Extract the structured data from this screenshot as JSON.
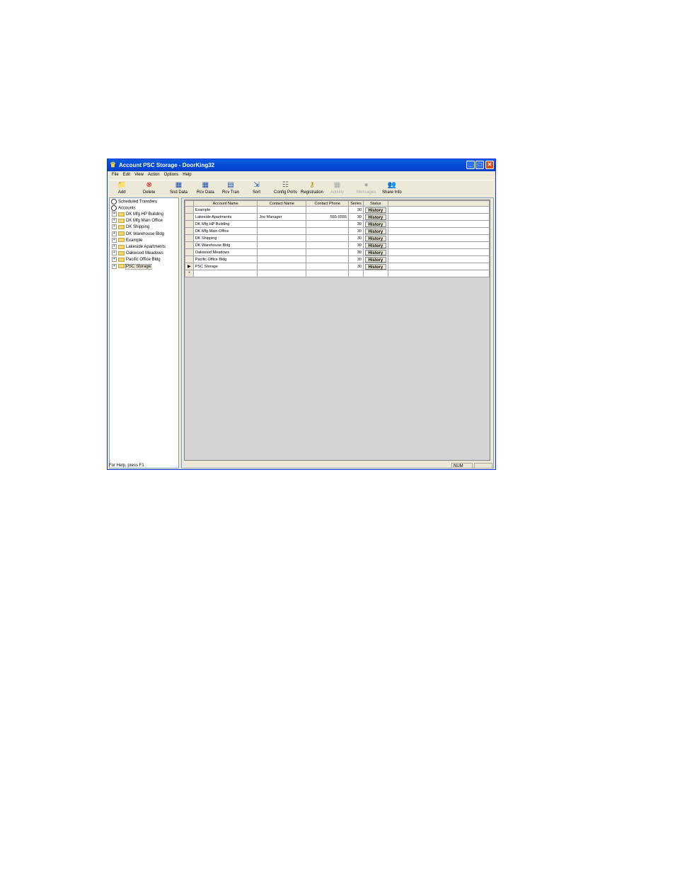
{
  "window": {
    "title": "Account PSC Storage - DoorKing32",
    "minimize_glyph": "_",
    "maximize_glyph": "□",
    "close_glyph": "✕"
  },
  "menu": [
    "File",
    "Edit",
    "View",
    "Action",
    "Options",
    "Help"
  ],
  "toolbar": [
    {
      "label": "Add",
      "icon": "add-folder-icon",
      "glyph": "📁",
      "color": "#c8a200",
      "enabled": true
    },
    {
      "label": "Delete",
      "icon": "delete-icon",
      "glyph": "⊗",
      "color": "#d90000",
      "enabled": true
    },
    {
      "label": "Snd Data",
      "icon": "send-data-icon",
      "glyph": "▦",
      "color": "#1a4fb0",
      "enabled": true
    },
    {
      "label": "Rcv Data",
      "icon": "receive-data-icon",
      "glyph": "▦",
      "color": "#1a4fb0",
      "enabled": true
    },
    {
      "label": "Rcv Tran",
      "icon": "receive-transactions-icon",
      "glyph": "▤",
      "color": "#1a4fb0",
      "enabled": true
    },
    {
      "label": "Sort",
      "icon": "sort-icon",
      "glyph": "⇲",
      "color": "#1a4fb0",
      "enabled": true
    },
    {
      "label": "Config Ports",
      "icon": "config-ports-icon",
      "glyph": "☷",
      "color": "#666666",
      "enabled": true
    },
    {
      "label": "Registration",
      "icon": "registration-key-icon",
      "glyph": "⚷",
      "color": "#b08a00",
      "enabled": true
    },
    {
      "label": "Activity",
      "icon": "activity-icon",
      "glyph": "▦",
      "color": "#a9a9a9",
      "enabled": false
    },
    {
      "label": "Messages",
      "icon": "messages-icon",
      "glyph": "●",
      "color": "#a9a9a9",
      "enabled": false
    },
    {
      "label": "Share Info",
      "icon": "share-info-icon",
      "glyph": "👥",
      "color": "#1a4fb0",
      "enabled": true
    }
  ],
  "tree": {
    "scheduled": "Scheduled Transfers",
    "accounts_root": "Accounts",
    "expand_glyph": "+",
    "accounts": [
      "DK Mfg HP Building",
      "DK Mfg Main Office",
      "DK Shipping",
      "DK Warehouse Bldg",
      "Example",
      "Lakeside Apartments",
      "Oakwood Meadows",
      "Pacific Office Bldg",
      "PSC Storage"
    ],
    "selected": "PSC Storage"
  },
  "grid": {
    "columns": [
      "Account Name",
      "Contact Name",
      "Contact Phone",
      "Series",
      "Status"
    ],
    "rows": [
      {
        "account": "Example",
        "contact": "",
        "phone": "",
        "series": "30",
        "status": "History"
      },
      {
        "account": "Lakeside Apartments",
        "contact": "Joe Manager",
        "phone": "555-5555",
        "series": "30",
        "status": "History"
      },
      {
        "account": "DK Mfg HP Building",
        "contact": "",
        "phone": "",
        "series": "30",
        "status": "History"
      },
      {
        "account": "DK Mfg Main Office",
        "contact": "",
        "phone": "",
        "series": "30",
        "status": "History"
      },
      {
        "account": "DK Shipping",
        "contact": "",
        "phone": "",
        "series": "30",
        "status": "History"
      },
      {
        "account": "DK Warehouse Bldg",
        "contact": "",
        "phone": "",
        "series": "30",
        "status": "History"
      },
      {
        "account": "Oakwood Meadows",
        "contact": "",
        "phone": "",
        "series": "30",
        "status": "History"
      },
      {
        "account": "Pacific Office Bldg",
        "contact": "",
        "phone": "",
        "series": "30",
        "status": "History"
      },
      {
        "account": "PSC Storage",
        "contact": "",
        "phone": "",
        "series": "30",
        "status": "History"
      }
    ],
    "current_row_marker": "▶",
    "new_row_marker": "*",
    "current_row_index": 8
  },
  "statusbar": {
    "help": "For Help, press F1",
    "num": "NUM"
  }
}
